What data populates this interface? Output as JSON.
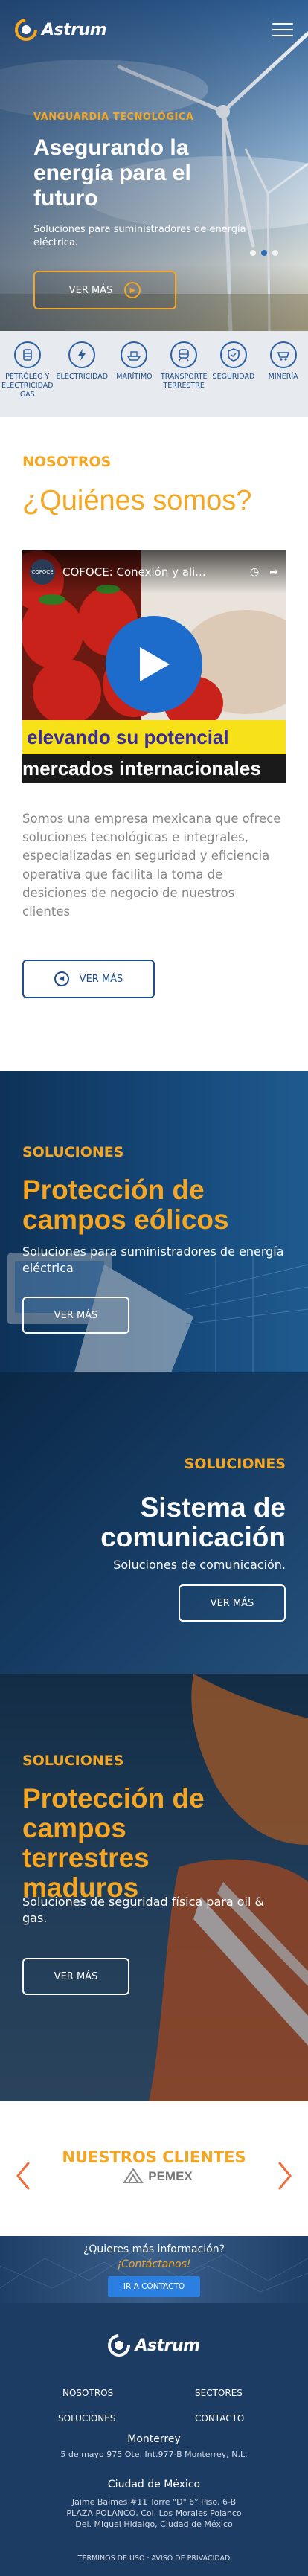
{
  "header": {
    "brand": "Astrum"
  },
  "hero": {
    "eyebrow": "VANGUARDIA TECNOLÓGICA",
    "title": "Asegurando la energía para el futuro",
    "subtitle": "Soluciones para suministradores de energía eléctrica.",
    "button": "VER MÁS",
    "slides": 3,
    "active_slide": 1
  },
  "sectors": [
    {
      "label": "PETRÓLEO Y ELECTRICIDAD GAS",
      "icon": "oil-barrel-icon"
    },
    {
      "label": "ELECTRICIDAD",
      "icon": "lightning-bolt-icon"
    },
    {
      "label": "MARÍTIMO",
      "icon": "ship-icon"
    },
    {
      "label": "TRANSPORTE TERRESTRE",
      "icon": "train-icon"
    },
    {
      "label": "SEGURIDAD",
      "icon": "shield-icon"
    },
    {
      "label": "MINERÍA",
      "icon": "mining-cart-icon"
    }
  ],
  "about": {
    "label": "NOSOTROS",
    "title": "¿Quiénes somos?",
    "video_channel": "COFOCE",
    "video_title": "COFOCE: Conexión y ali...",
    "video_band_1": "elevando su potencial",
    "video_band_2": "mercados internacionales",
    "text": "Somos una empresa mexicana que ofrece soluciones tecnológicas e integrales, especializadas en seguridad y eficiencia operativa que facilita la toma de desiciones de negocio de nuestros clientes",
    "button": "VER MÁS"
  },
  "solutions": [
    {
      "label": "SOLUCIONES",
      "title": "Protección de campos eólicos",
      "subtitle": "Soluciones para suministradores de energía eléctrica",
      "button": "VER MÁS"
    },
    {
      "label": "SOLUCIONES",
      "title": "Sistema de comunicación",
      "subtitle": "Soluciones de comunicación.",
      "button": "VER MÁS"
    },
    {
      "label": "SOLUCIONES",
      "title": "Protección de campos terrestres maduros",
      "subtitle": "Soluciones de seguridad física para oil & gas.",
      "button": "VER MÁS"
    }
  ],
  "clients": {
    "title": "NUESTROS CLIENTES",
    "logo": "PEMEX"
  },
  "contact": {
    "question": "¿Quieres más información?",
    "cta": "¡Contáctanos!",
    "button": "IR A CONTACTO"
  },
  "footer": {
    "brand": "Astrum",
    "links": [
      "NOSOTROS",
      "SECTORES",
      "SOLUCIONES",
      "CONTACTO"
    ],
    "city_1": "Monterrey",
    "address_1": "5 de mayo 975 Ote. Int.977-B Monterrey, N.L.",
    "city_2": "Ciudad de México",
    "address_2a": "Jaime Balmes #11 Torre \"D\" 6° Piso, 6-B",
    "address_2b": "PLAZA POLANCO, Col. Los Morales Polanco",
    "address_2c": "Del. Miguel Hidalgo, Ciudad de México",
    "legal": "TÉRMINOS DE USO  ·  AVISO DE PRIVACIDAD"
  },
  "colors": {
    "accent": "#f5a623",
    "primary": "#1f4e8f",
    "footer": "#1d3c63"
  }
}
